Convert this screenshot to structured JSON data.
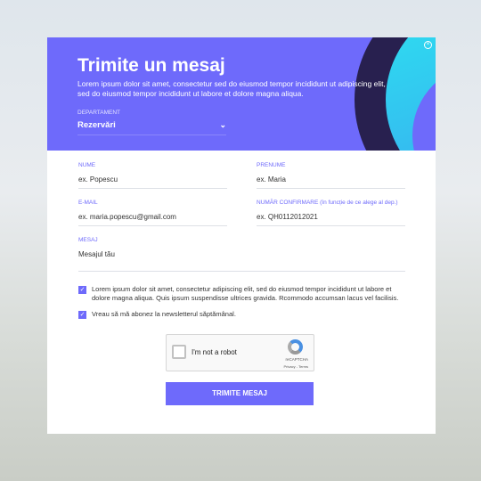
{
  "header": {
    "title": "Trimite un mesaj",
    "subtitle": "Lorem ipsum dolor sit amet, consectetur sed do eiusmod tempor incididunt ut  adipiscing elit, sed do eiusmod tempor incididunt ut labore et dolore magna aliqua.",
    "close_icon": "close-circle-icon",
    "accent": "#6e6afb"
  },
  "department": {
    "label": "DEPARTAMENT",
    "value": "Rezervări",
    "chevron": "⌄"
  },
  "fields": {
    "nume": {
      "label": "NUME",
      "placeholder": "ex. Popescu"
    },
    "prenume": {
      "label": "PRENUME",
      "placeholder": "ex. Maria"
    },
    "email": {
      "label": "E-MAIL",
      "placeholder": "ex. maria.popescu@gmail.com"
    },
    "confirmare": {
      "label": "NUMĂR CONFIRMARE (în funcție de ce alege al dep.)",
      "placeholder": "ex. QH0112012021"
    },
    "mesaj": {
      "label": "MESAJ",
      "placeholder": "Mesajul tău"
    }
  },
  "checkboxes": [
    {
      "label": "Lorem ipsum dolor sit amet, consectetur adipiscing elit, sed do eiusmod tempor incididunt ut labore et dolore magna aliqua. Quis ipsum suspendisse ultrices gravida. Rcommodo accumsan lacus vel facilisis.",
      "checked": true
    },
    {
      "label": "Vreau să mă abonez la newsletterul săptămânal.",
      "checked": true
    }
  ],
  "captcha": {
    "label": "I'm not a robot",
    "brand": "reCAPTCHA",
    "links": "Privacy - Terms"
  },
  "submit": {
    "label": "TRIMITE MESAJ"
  }
}
